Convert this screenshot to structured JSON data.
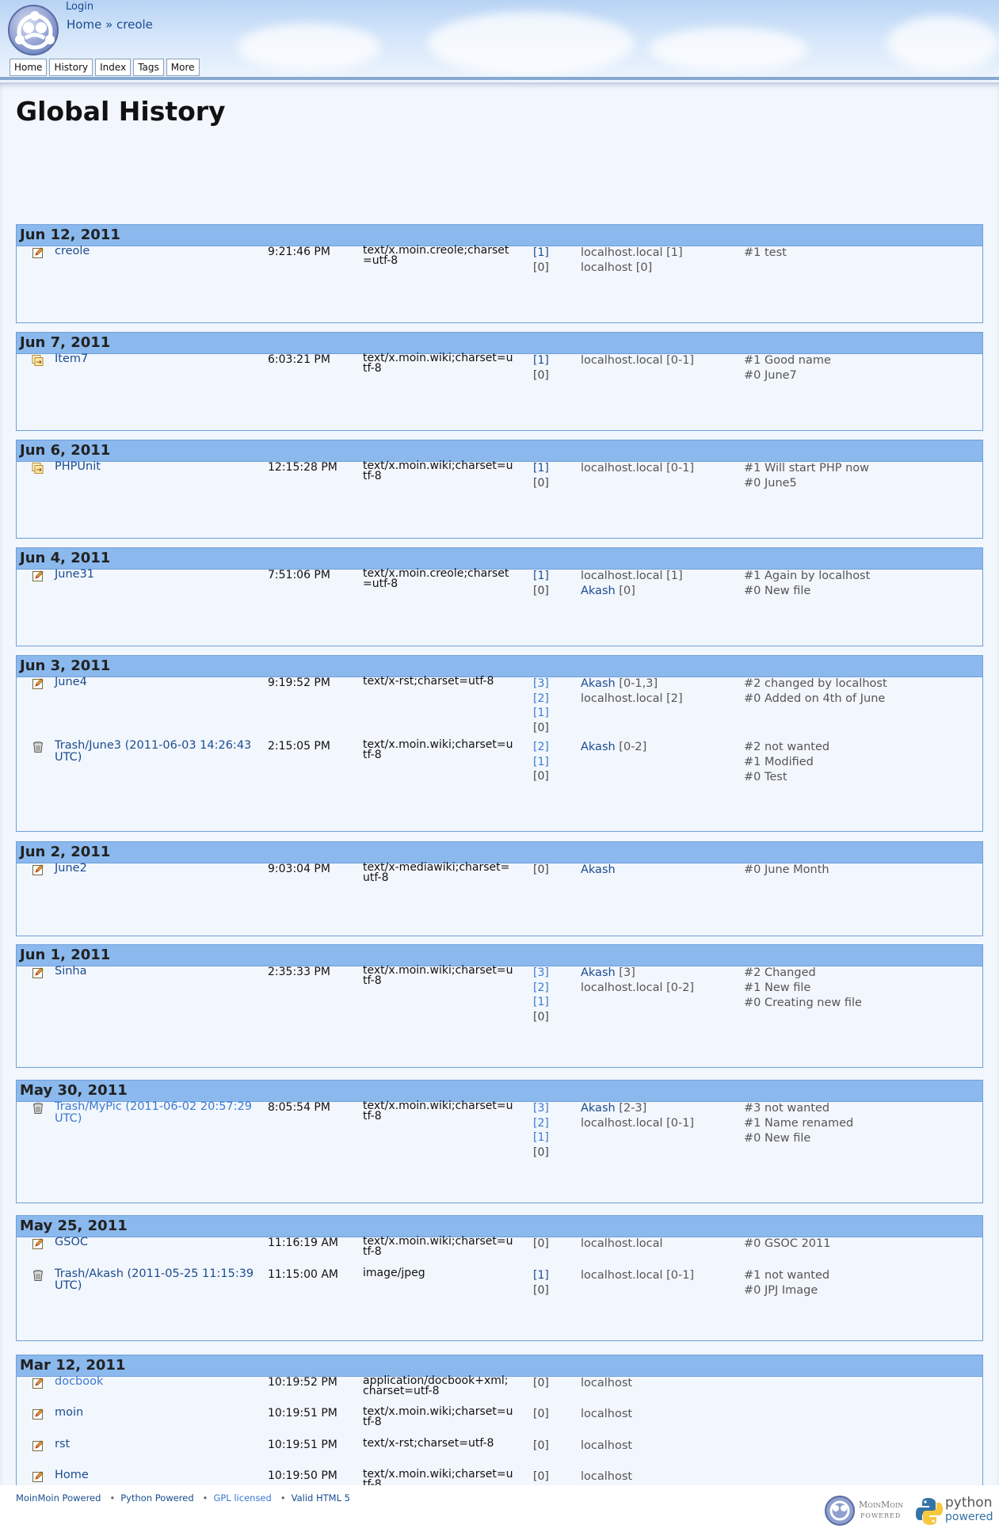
{
  "header": {
    "login": "Login",
    "breadcrumb_home": "Home",
    "breadcrumb_sep": " » ",
    "breadcrumb_current": "creole",
    "nav": [
      "Home",
      "History",
      "Index",
      "Tags",
      "More"
    ]
  },
  "page_title": "Global History",
  "days": [
    {
      "date": "Jun 12, 2011",
      "rows": [
        {
          "icon": "edit-icon",
          "name": "creole",
          "time": "9:21:46 PM",
          "ctype": "text/x.moin.creole;charset=utf-8",
          "revs": [
            "[1]",
            "[0]"
          ],
          "authors": [
            "localhost.local [1]",
            "localhost [0]"
          ],
          "comments": [
            "#1 test"
          ]
        }
      ]
    },
    {
      "date": "Jun 7, 2011",
      "rows": [
        {
          "icon": "rename-icon",
          "name": "Item7",
          "time": "6:03:21 PM",
          "ctype": "text/x.moin.wiki;charset=utf-8",
          "revs": [
            "[1]",
            "[0]"
          ],
          "authors": [
            "localhost.local [0-1]"
          ],
          "comments": [
            "#1 Good name",
            "#0 June7"
          ]
        }
      ]
    },
    {
      "date": "Jun 6, 2011",
      "rows": [
        {
          "icon": "rename-icon",
          "name": "PHPUnit",
          "time": "12:15:28 PM",
          "ctype": "text/x.moin.wiki;charset=utf-8",
          "revs": [
            "[1]",
            "[0]"
          ],
          "authors": [
            "localhost.local [0-1]"
          ],
          "comments": [
            "#1 Will start PHP now",
            "#0 June5"
          ]
        }
      ]
    },
    {
      "date": "Jun 4, 2011",
      "rows": [
        {
          "icon": "edit-icon",
          "name": "June31",
          "time": "7:51:06 PM",
          "ctype": "text/x.moin.creole;charset=utf-8",
          "revs": [
            "[1]",
            "[0]"
          ],
          "authors": [
            "localhost.local [1]",
            "Akash [0]"
          ],
          "comments": [
            "#1 Again by localhost",
            "#0 New file"
          ]
        }
      ]
    },
    {
      "date": "Jun 3, 2011",
      "rows": [
        {
          "icon": "edit-icon",
          "name": "June4",
          "time": "9:19:52 PM",
          "ctype": "text/x-rst;charset=utf-8",
          "revs": [
            "[3]",
            "[2]",
            "[1]",
            "[0]"
          ],
          "authors": [
            "Akash [0-1,3]",
            "localhost.local [2]"
          ],
          "comments": [
            "#2 changed by localhost",
            "#0 Added on 4th of June"
          ]
        },
        {
          "icon": "trash-icon",
          "name": "Trash/June3 (2011-06-03 14:26:43 UTC)",
          "time": "2:15:05 PM",
          "ctype": "text/x.moin.wiki;charset=utf-8",
          "revs": [
            "[2]",
            "[1]",
            "[0]"
          ],
          "authors": [
            "Akash [0-2]"
          ],
          "comments": [
            "#2 not wanted",
            "#1 Modified",
            "#0 Test"
          ]
        }
      ]
    },
    {
      "date": "Jun 2, 2011",
      "rows": [
        {
          "icon": "edit-icon",
          "name": "June2",
          "time": "9:03:04 PM",
          "ctype": "text/x-mediawiki;charset=utf-8",
          "revs": [
            "[0]"
          ],
          "authors": [
            "Akash"
          ],
          "comments": [
            "#0 June Month"
          ]
        }
      ]
    },
    {
      "date": "Jun 1, 2011",
      "rows": [
        {
          "icon": "edit-icon",
          "name": "Sinha",
          "time": "2:35:33 PM",
          "ctype": "text/x.moin.wiki;charset=utf-8",
          "revs": [
            "[3]",
            "[2]",
            "[1]",
            "[0]"
          ],
          "authors": [
            "Akash [3]",
            "localhost.local [0-2]"
          ],
          "comments": [
            "#2 Changed",
            "#1 New file",
            "#0 Creating new file"
          ]
        }
      ]
    },
    {
      "date": "May 30, 2011",
      "rows": [
        {
          "icon": "trash-icon",
          "name": "Trash/MyPic (2011-06-02 20:57:29 UTC)",
          "time": "8:05:54 PM",
          "ctype": "text/x.moin.wiki;charset=utf-8",
          "revs": [
            "[3]",
            "[2]",
            "[1]",
            "[0]"
          ],
          "authors": [
            "Akash [2-3]",
            "localhost.local [0-1]"
          ],
          "comments": [
            "#3 not wanted",
            "#1 Name renamed",
            "#0 New file"
          ]
        }
      ]
    },
    {
      "date": "May 25, 2011",
      "rows": [
        {
          "icon": "edit-icon",
          "name": "GSOC",
          "time": "11:16:19 AM",
          "ctype": "text/x.moin.wiki;charset=utf-8",
          "revs": [
            "[0]"
          ],
          "authors": [
            "localhost.local"
          ],
          "comments": [
            "#0 GSOC 2011"
          ]
        },
        {
          "icon": "trash-icon",
          "name": "Trash/Akash (2011-05-25 11:15:39 UTC)",
          "time": "11:15:00 AM",
          "ctype": "image/jpeg",
          "revs": [
            "[1]",
            "[0]"
          ],
          "authors": [
            "localhost.local [0-1]"
          ],
          "comments": [
            "#1 not wanted",
            "#0 JPJ Image"
          ]
        }
      ]
    },
    {
      "date": "Mar 12, 2011",
      "rows": [
        {
          "icon": "edit-icon",
          "name": "docbook",
          "time": "10:19:52 PM",
          "ctype": "application/docbook+xml;charset=utf-8",
          "revs": [
            "[0]"
          ],
          "authors": [
            "localhost"
          ],
          "comments": []
        },
        {
          "icon": "edit-icon",
          "name": "moin",
          "time": "10:19:51 PM",
          "ctype": "text/x.moin.wiki;charset=utf-8",
          "revs": [
            "[0]"
          ],
          "authors": [
            "localhost"
          ],
          "comments": []
        },
        {
          "icon": "edit-icon",
          "name": "rst",
          "time": "10:19:51 PM",
          "ctype": "text/x-rst;charset=utf-8",
          "revs": [
            "[0]"
          ],
          "authors": [
            "localhost"
          ],
          "comments": []
        },
        {
          "icon": "edit-icon",
          "name": "Home",
          "time": "10:19:50 PM",
          "ctype": "text/x.moin.wiki;charset=utf-8",
          "revs": [
            "[0]"
          ],
          "authors": [
            "localhost"
          ],
          "comments": []
        }
      ]
    }
  ],
  "footer": {
    "links": [
      "MoinMoin Powered",
      "Python Powered",
      "GPL licensed",
      "Valid HTML 5"
    ],
    "separator": "•",
    "moin_badge": "MoinMoin",
    "moin_badge_sub": "POWERED",
    "python_badge": "python",
    "python_badge_sub": "powered"
  }
}
